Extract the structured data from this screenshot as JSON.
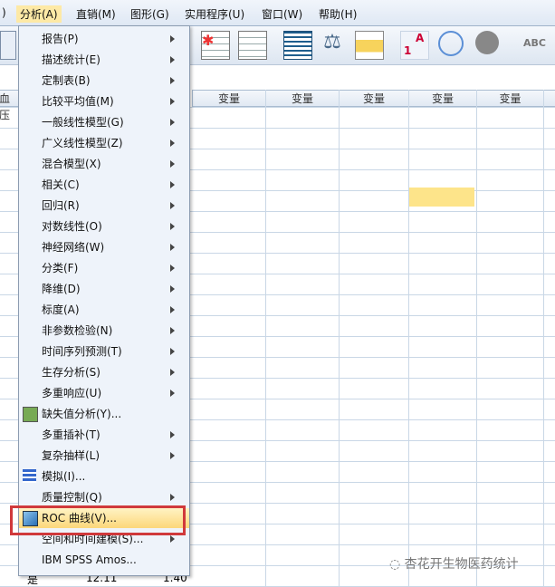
{
  "menubar": [
    {
      "label": ")"
    },
    {
      "label": "分析(A)"
    },
    {
      "label": "直销(M)"
    },
    {
      "label": "图形(G)"
    },
    {
      "label": "实用程序(U)"
    },
    {
      "label": "窗口(W)"
    },
    {
      "label": "帮助(H)"
    }
  ],
  "grid": {
    "row_header_partial": "血压",
    "col_header": "变量",
    "bottom_partial": [
      "是",
      "12.11",
      "1.40"
    ]
  },
  "menu": {
    "items": [
      {
        "label": "报告(P)",
        "submenu": true
      },
      {
        "label": "描述统计(E)",
        "submenu": true
      },
      {
        "label": "定制表(B)",
        "submenu": true
      },
      {
        "label": "比较平均值(M)",
        "submenu": true
      },
      {
        "label": "一般线性模型(G)",
        "submenu": true
      },
      {
        "label": "广义线性模型(Z)",
        "submenu": true
      },
      {
        "label": "混合模型(X)",
        "submenu": true
      },
      {
        "label": "相关(C)",
        "submenu": true
      },
      {
        "label": "回归(R)",
        "submenu": true
      },
      {
        "label": "对数线性(O)",
        "submenu": true
      },
      {
        "label": "神经网络(W)",
        "submenu": true
      },
      {
        "label": "分类(F)",
        "submenu": true
      },
      {
        "label": "降维(D)",
        "submenu": true
      },
      {
        "label": "标度(A)",
        "submenu": true
      },
      {
        "label": "非参数检验(N)",
        "submenu": true
      },
      {
        "label": "时间序列预测(T)",
        "submenu": true
      },
      {
        "label": "生存分析(S)",
        "submenu": true
      },
      {
        "label": "多重响应(U)",
        "submenu": true
      },
      {
        "label": "缺失值分析(Y)...",
        "submenu": false,
        "icon": "missing-value-icon"
      },
      {
        "label": "多重插补(T)",
        "submenu": true
      },
      {
        "label": "复杂抽样(L)",
        "submenu": true
      },
      {
        "label": "模拟(I)...",
        "submenu": false,
        "icon": "simulation-icon"
      },
      {
        "label": "质量控制(Q)",
        "submenu": true
      },
      {
        "label": "ROC 曲线(V)...",
        "submenu": false,
        "icon": "roc-curve-icon",
        "selected": true
      },
      {
        "label": "空间和时间建模(S)...",
        "submenu": true
      },
      {
        "label": "IBM SPSS Amos...",
        "submenu": false
      }
    ]
  },
  "watermark": "杏花开生物医药统计"
}
